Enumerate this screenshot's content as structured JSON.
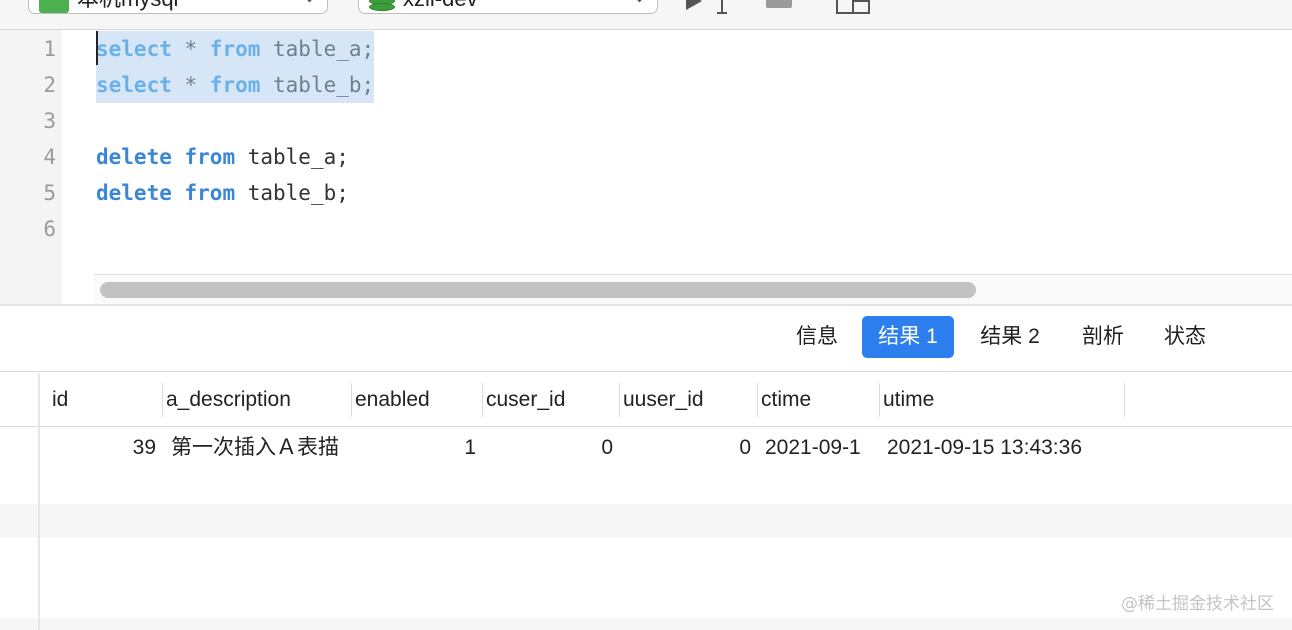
{
  "toolbar": {
    "connection_label": "本机mysql",
    "database_label": "xzll-dev"
  },
  "editor": {
    "line_numbers": [
      "1",
      "2",
      "3",
      "4",
      "5",
      "6"
    ],
    "lines": [
      {
        "keyword": "select",
        "star": " * ",
        "keyword2": "from",
        "rest": " table_a;"
      },
      {
        "keyword": "select",
        "star": " * ",
        "keyword2": "from",
        "rest": " table_b;"
      },
      {
        "keyword": "",
        "star": "",
        "keyword2": "",
        "rest": ""
      },
      {
        "keyword": "delete",
        "star": " ",
        "keyword2": "from",
        "rest": " table_a;"
      },
      {
        "keyword": "delete",
        "star": " ",
        "keyword2": "from",
        "rest": " table_b;"
      },
      {
        "keyword": "",
        "star": "",
        "keyword2": "",
        "rest": ""
      }
    ],
    "selected_lines": [
      1,
      2
    ]
  },
  "tabs": [
    {
      "label": "信息",
      "active": false
    },
    {
      "label": "结果 1",
      "active": true
    },
    {
      "label": "结果 2",
      "active": false
    },
    {
      "label": "剖析",
      "active": false
    },
    {
      "label": "状态",
      "active": false
    }
  ],
  "grid": {
    "columns": [
      "id",
      "a_description",
      "enabled",
      "cuser_id",
      "uuser_id",
      "ctime",
      "utime"
    ],
    "rows": [
      [
        "39",
        "第一次插入Ａ表描",
        "1",
        "0",
        "0",
        "2021-09-1",
        "2021-09-15 13:43:36"
      ]
    ]
  },
  "watermark": "@稀土掘金技术社区",
  "colors": {
    "keyword": "#3a87d6",
    "selection": "#d6e6f7",
    "active_tab": "#2d7ff0",
    "connection_icon": "#4caf50",
    "database_icon": "#3f9e3c"
  }
}
